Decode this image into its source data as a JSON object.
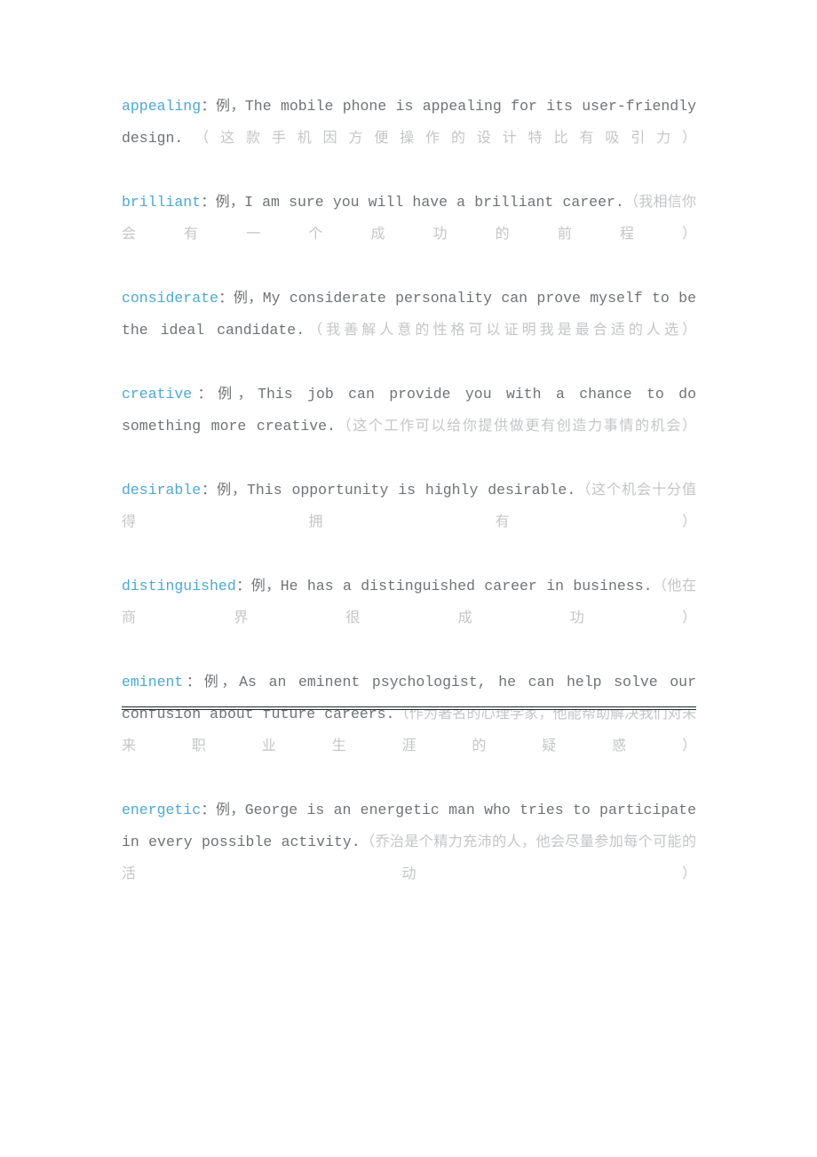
{
  "document": {
    "type": "vocabulary-glossary",
    "language_pair": "English-Chinese",
    "headword_color": "#4BA9D4",
    "body_color": "#6f7376",
    "translation_color": "#c3c5c7",
    "rule_color": "#1d2b2b",
    "separator": "：",
    "example_marker": "例，",
    "entries": [
      {
        "headword": "appealing",
        "marker": "例，",
        "example_en": "The mobile phone is appealing for its user-friendly design.",
        "translation_zh": "（这款手机因方便操作的设计特比有吸引力）"
      },
      {
        "headword": "brilliant",
        "marker": "例，",
        "example_en": "I am sure you will have a brilliant career.",
        "translation_zh": "（我相信你会有一个成功的前程）"
      },
      {
        "headword": "considerate",
        "marker": "例，",
        "example_en": "My considerate personality can prove myself to be the ideal candidate.",
        "translation_zh": "（我善解人意的性格可以证明我是最合适的人选）"
      },
      {
        "headword": "creative",
        "marker": "例，",
        "example_en": "This job can provide you with a chance to do something more creative.",
        "translation_zh": "（这个工作可以给你提供做更有创造力事情的机会）"
      },
      {
        "headword": "desirable",
        "marker": "例，",
        "example_en": "This opportunity is highly desirable.",
        "translation_zh": "（这个机会十分值得拥有）"
      },
      {
        "headword": "distinguished",
        "marker": "例，",
        "example_en": "He has a distinguished career in business.",
        "translation_zh": "（他在商界很成功）"
      },
      {
        "headword": "eminent",
        "marker": "例，",
        "example_en": "As an eminent psychologist, he can help solve our confusion about future careers.",
        "translation_zh": "（作为著名的心理学家，他能帮助解决我们对未来职业生涯的疑惑）"
      },
      {
        "headword": "energetic",
        "marker": "例，",
        "example_en": "George is an energetic man who tries to participate in every possible activity.",
        "translation_zh": "（乔治是个精力充沛的人，他会尽量参加每个可能的活动）"
      }
    ]
  }
}
